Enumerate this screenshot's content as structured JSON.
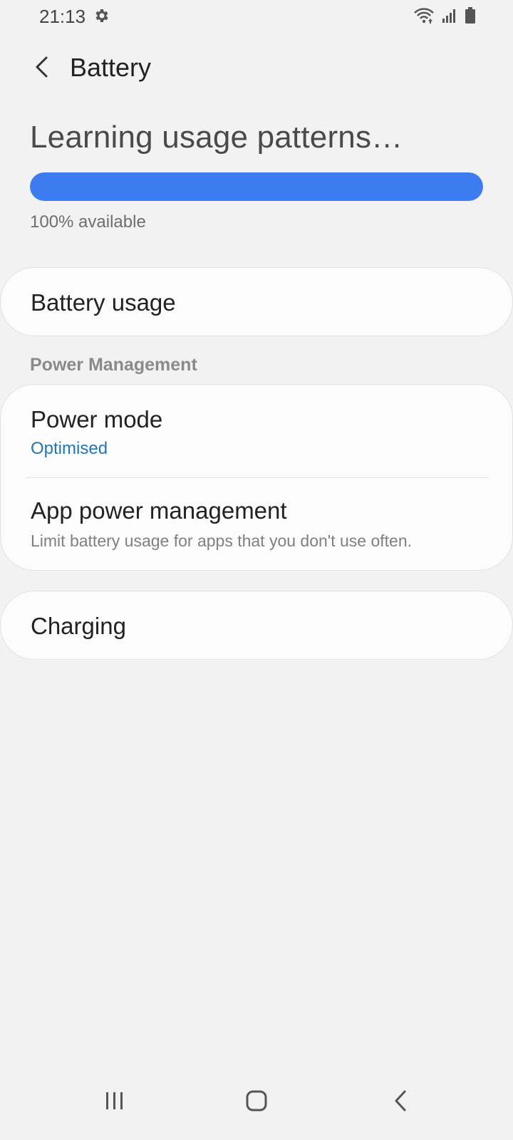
{
  "status_bar": {
    "time": "21:13",
    "icons": [
      "settings-gear-icon",
      "wifi-icon",
      "signal-icon",
      "battery-icon"
    ]
  },
  "header": {
    "title": "Battery"
  },
  "battery": {
    "status_text": "Learning usage patterns…",
    "level_percent": 100,
    "available_text": "100% available",
    "bar_color": "#3d7bf1"
  },
  "items": {
    "battery_usage": "Battery usage",
    "charging": "Charging"
  },
  "power_management": {
    "section_label": "Power Management",
    "power_mode": {
      "title": "Power mode",
      "value": "Optimised"
    },
    "app_power": {
      "title": "App power management",
      "description": "Limit battery usage for apps that you don't use often."
    }
  },
  "nav_bar": {
    "icons": [
      "recents-icon",
      "home-icon",
      "back-nav-icon"
    ]
  },
  "colors": {
    "background": "#f2f2f2",
    "card": "#fcfcfc",
    "accent_blue": "#1f77b4"
  }
}
